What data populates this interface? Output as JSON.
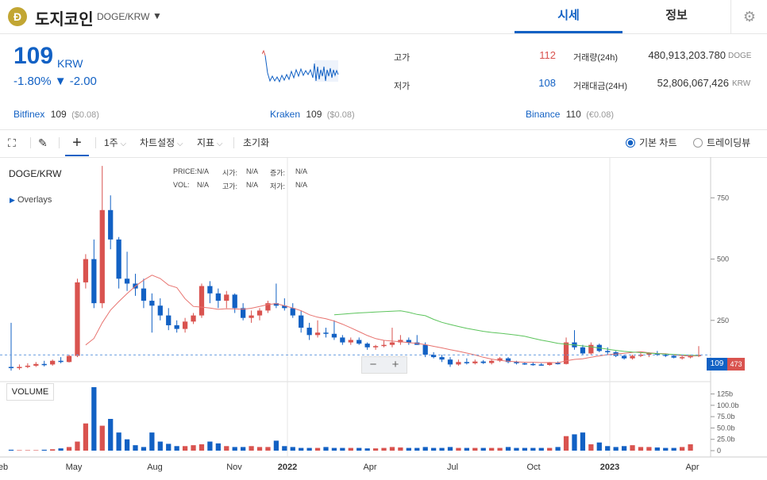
{
  "header": {
    "coin_icon_glyph": "Ð",
    "coin_name": "도지코인",
    "pair": "DOGE/KRW",
    "tabs": [
      {
        "label": "시세"
      },
      {
        "label": "정보"
      }
    ]
  },
  "ticker": {
    "price": "109",
    "unit": "KRW",
    "change": "-1.80% ▼ -2.00",
    "high_label": "고가",
    "high": "112",
    "low_label": "저가",
    "low": "108",
    "vol_label": "거래량(24h)",
    "vol": "480,913,203.780",
    "vol_unit": "DOGE",
    "amt_label": "거래대금(24H)",
    "amt": "52,806,067,426",
    "amt_unit": "KRW"
  },
  "exchanges": [
    {
      "name": "Bitfinex",
      "price": "109",
      "sub": "($0.08)"
    },
    {
      "name": "Kraken",
      "price": "109",
      "sub": "($0.08)"
    },
    {
      "name": "Binance",
      "price": "110",
      "sub": "(€0.08)"
    }
  ],
  "toolbar": {
    "interval": "1주",
    "chart_settings": "차트설정",
    "indicators": "지표",
    "reset": "초기화",
    "basic_chart": "기본 차트",
    "tradingview": "트레이딩뷰"
  },
  "chart": {
    "title": "DOGE/KRW",
    "overlays": "Overlays",
    "ohlc": {
      "price_label": "PRICE:",
      "price": "N/A",
      "open_label": "시가:",
      "open": "N/A",
      "change_label": "증가:",
      "change": "N/A",
      "vol_label": "VOL:",
      "vol": "N/A",
      "high_label": "고가:",
      "high": "N/A",
      "low_label": "저가:",
      "low": "N/A"
    },
    "volume_label": "VOLUME",
    "zoom_out": "−",
    "zoom_in": "+",
    "current_price_tag": "109",
    "ma_tag": "473",
    "up_color": "#d9534f",
    "down_color": "#1261c4"
  },
  "chart_data": {
    "type": "candlestick",
    "price_axis_ticks": [
      "750",
      "500",
      "250"
    ],
    "volume_axis_ticks": [
      "125b",
      "100.0b",
      "75.0b",
      "50.0b",
      "25.0b",
      "0"
    ],
    "x_tick_labels": [
      "eb",
      "May",
      "Aug",
      "Nov",
      "2022",
      "Apr",
      "Jul",
      "Oct",
      "2023",
      "Apr"
    ],
    "candles": [
      {
        "o": 60,
        "h": 240,
        "l": 45,
        "c": 55
      },
      {
        "o": 55,
        "h": 70,
        "l": 48,
        "c": 60
      },
      {
        "o": 60,
        "h": 75,
        "l": 55,
        "c": 65
      },
      {
        "o": 65,
        "h": 80,
        "l": 60,
        "c": 72
      },
      {
        "o": 72,
        "h": 85,
        "l": 62,
        "c": 70
      },
      {
        "o": 70,
        "h": 90,
        "l": 65,
        "c": 85
      },
      {
        "o": 85,
        "h": 100,
        "l": 75,
        "c": 80
      },
      {
        "o": 80,
        "h": 110,
        "l": 78,
        "c": 105
      },
      {
        "o": 105,
        "h": 420,
        "l": 100,
        "c": 405
      },
      {
        "o": 405,
        "h": 520,
        "l": 380,
        "c": 500
      },
      {
        "o": 500,
        "h": 580,
        "l": 300,
        "c": 320
      },
      {
        "o": 320,
        "h": 880,
        "l": 300,
        "c": 700
      },
      {
        "o": 700,
        "h": 760,
        "l": 540,
        "c": 580
      },
      {
        "o": 580,
        "h": 590,
        "l": 380,
        "c": 420
      },
      {
        "o": 420,
        "h": 530,
        "l": 370,
        "c": 400
      },
      {
        "o": 400,
        "h": 440,
        "l": 350,
        "c": 380
      },
      {
        "o": 380,
        "h": 420,
        "l": 300,
        "c": 330
      },
      {
        "o": 330,
        "h": 360,
        "l": 200,
        "c": 310
      },
      {
        "o": 310,
        "h": 340,
        "l": 250,
        "c": 270
      },
      {
        "o": 270,
        "h": 300,
        "l": 210,
        "c": 230
      },
      {
        "o": 230,
        "h": 250,
        "l": 200,
        "c": 215
      },
      {
        "o": 215,
        "h": 260,
        "l": 200,
        "c": 245
      },
      {
        "o": 245,
        "h": 280,
        "l": 235,
        "c": 270
      },
      {
        "o": 270,
        "h": 400,
        "l": 260,
        "c": 390
      },
      {
        "o": 390,
        "h": 410,
        "l": 320,
        "c": 360
      },
      {
        "o": 360,
        "h": 380,
        "l": 300,
        "c": 330
      },
      {
        "o": 330,
        "h": 370,
        "l": 300,
        "c": 355
      },
      {
        "o": 355,
        "h": 360,
        "l": 280,
        "c": 300
      },
      {
        "o": 300,
        "h": 320,
        "l": 250,
        "c": 260
      },
      {
        "o": 260,
        "h": 290,
        "l": 240,
        "c": 270
      },
      {
        "o": 270,
        "h": 300,
        "l": 250,
        "c": 290
      },
      {
        "o": 290,
        "h": 330,
        "l": 280,
        "c": 320
      },
      {
        "o": 320,
        "h": 400,
        "l": 300,
        "c": 310
      },
      {
        "o": 310,
        "h": 340,
        "l": 290,
        "c": 300
      },
      {
        "o": 300,
        "h": 320,
        "l": 260,
        "c": 270
      },
      {
        "o": 270,
        "h": 290,
        "l": 200,
        "c": 220
      },
      {
        "o": 220,
        "h": 240,
        "l": 170,
        "c": 190
      },
      {
        "o": 190,
        "h": 250,
        "l": 180,
        "c": 200
      },
      {
        "o": 200,
        "h": 220,
        "l": 180,
        "c": 195
      },
      {
        "o": 195,
        "h": 250,
        "l": 170,
        "c": 180
      },
      {
        "o": 180,
        "h": 190,
        "l": 150,
        "c": 160
      },
      {
        "o": 160,
        "h": 180,
        "l": 150,
        "c": 170
      },
      {
        "o": 170,
        "h": 180,
        "l": 150,
        "c": 155
      },
      {
        "o": 155,
        "h": 160,
        "l": 130,
        "c": 140
      },
      {
        "o": 140,
        "h": 150,
        "l": 130,
        "c": 145
      },
      {
        "o": 145,
        "h": 170,
        "l": 140,
        "c": 150
      },
      {
        "o": 150,
        "h": 220,
        "l": 140,
        "c": 160
      },
      {
        "o": 160,
        "h": 190,
        "l": 150,
        "c": 170
      },
      {
        "o": 170,
        "h": 180,
        "l": 150,
        "c": 160
      },
      {
        "o": 160,
        "h": 190,
        "l": 150,
        "c": 150
      },
      {
        "o": 150,
        "h": 160,
        "l": 100,
        "c": 110
      },
      {
        "o": 110,
        "h": 120,
        "l": 95,
        "c": 100
      },
      {
        "o": 100,
        "h": 110,
        "l": 80,
        "c": 90
      },
      {
        "o": 90,
        "h": 100,
        "l": 60,
        "c": 70
      },
      {
        "o": 70,
        "h": 90,
        "l": 65,
        "c": 80
      },
      {
        "o": 80,
        "h": 95,
        "l": 70,
        "c": 75
      },
      {
        "o": 75,
        "h": 90,
        "l": 70,
        "c": 82
      },
      {
        "o": 82,
        "h": 88,
        "l": 72,
        "c": 76
      },
      {
        "o": 76,
        "h": 90,
        "l": 70,
        "c": 85
      },
      {
        "o": 85,
        "h": 100,
        "l": 80,
        "c": 95
      },
      {
        "o": 95,
        "h": 100,
        "l": 75,
        "c": 80
      },
      {
        "o": 80,
        "h": 85,
        "l": 70,
        "c": 75
      },
      {
        "o": 75,
        "h": 80,
        "l": 68,
        "c": 72
      },
      {
        "o": 72,
        "h": 78,
        "l": 65,
        "c": 70
      },
      {
        "o": 70,
        "h": 75,
        "l": 65,
        "c": 68
      },
      {
        "o": 68,
        "h": 80,
        "l": 65,
        "c": 76
      },
      {
        "o": 76,
        "h": 82,
        "l": 70,
        "c": 72
      },
      {
        "o": 72,
        "h": 180,
        "l": 70,
        "c": 160
      },
      {
        "o": 160,
        "h": 210,
        "l": 130,
        "c": 140
      },
      {
        "o": 140,
        "h": 150,
        "l": 110,
        "c": 115
      },
      {
        "o": 115,
        "h": 160,
        "l": 110,
        "c": 150
      },
      {
        "o": 150,
        "h": 155,
        "l": 120,
        "c": 125
      },
      {
        "o": 125,
        "h": 140,
        "l": 110,
        "c": 120
      },
      {
        "o": 120,
        "h": 125,
        "l": 100,
        "c": 105
      },
      {
        "o": 105,
        "h": 110,
        "l": 90,
        "c": 95
      },
      {
        "o": 95,
        "h": 110,
        "l": 90,
        "c": 105
      },
      {
        "o": 105,
        "h": 120,
        "l": 100,
        "c": 110
      },
      {
        "o": 110,
        "h": 120,
        "l": 100,
        "c": 115
      },
      {
        "o": 115,
        "h": 125,
        "l": 105,
        "c": 110
      },
      {
        "o": 110,
        "h": 115,
        "l": 100,
        "c": 105
      },
      {
        "o": 105,
        "h": 110,
        "l": 95,
        "c": 98
      },
      {
        "o": 98,
        "h": 105,
        "l": 90,
        "c": 100
      },
      {
        "o": 100,
        "h": 110,
        "l": 95,
        "c": 104
      },
      {
        "o": 104,
        "h": 145,
        "l": 100,
        "c": 109
      }
    ],
    "volumes": [
      2,
      1,
      1,
      1,
      2,
      3,
      5,
      8,
      20,
      60,
      140,
      55,
      70,
      40,
      25,
      12,
      8,
      40,
      20,
      15,
      10,
      10,
      12,
      14,
      20,
      16,
      10,
      8,
      8,
      10,
      8,
      8,
      22,
      10,
      8,
      6,
      6,
      6,
      8,
      6,
      6,
      6,
      6,
      5,
      5,
      6,
      8,
      7,
      6,
      6,
      8,
      6,
      6,
      8,
      6,
      6,
      6,
      6,
      6,
      6,
      8,
      6,
      6,
      6,
      6,
      6,
      8,
      32,
      36,
      40,
      14,
      18,
      10,
      8,
      10,
      12,
      8,
      8,
      7,
      6,
      6,
      8,
      14
    ]
  }
}
